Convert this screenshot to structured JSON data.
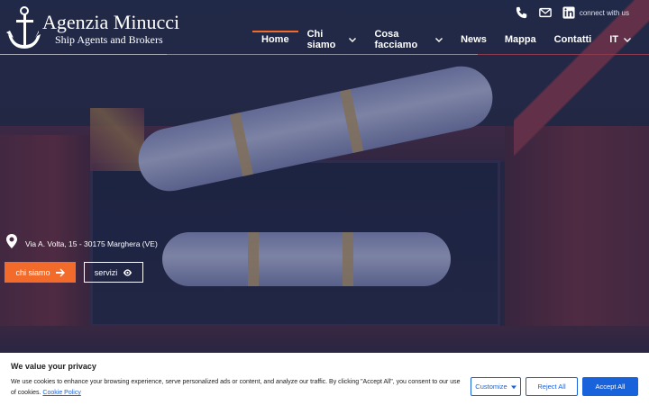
{
  "logo": {
    "name": "Agenzia Minucci",
    "subtitle": "Ship Agents and Brokers"
  },
  "topbar": {
    "phone_icon": "phone-icon",
    "email_icon": "envelope-icon",
    "linkedin_icon": "linkedin-icon",
    "connect_text": "connect with us"
  },
  "nav": {
    "items": [
      {
        "label": "Home",
        "active": true
      },
      {
        "label": "Chi siamo",
        "dropdown": true
      },
      {
        "label": "Cosa facciamo",
        "dropdown": true
      },
      {
        "label": "News"
      },
      {
        "label": "Mappa"
      },
      {
        "label": "Contatti"
      },
      {
        "label": "IT",
        "dropdown": true
      }
    ]
  },
  "hero": {
    "address": "Via A. Volta, 15 - 30175 Marghera (VE)",
    "btn_primary": "chi siamo",
    "btn_secondary": "servizi"
  },
  "cookie": {
    "title": "We value your privacy",
    "text": "We use cookies to enhance your browsing experience, serve personalized ads or content, and analyze our traffic. By clicking \"Accept All\", you consent to our use of cookies.",
    "link": "Cookie Policy",
    "customize": "Customize",
    "reject": "Reject All",
    "accept": "Accept All"
  },
  "colors": {
    "accent": "#f26b2b",
    "cookie_blue": "#1863dc",
    "hero_bg": "#27314f"
  }
}
